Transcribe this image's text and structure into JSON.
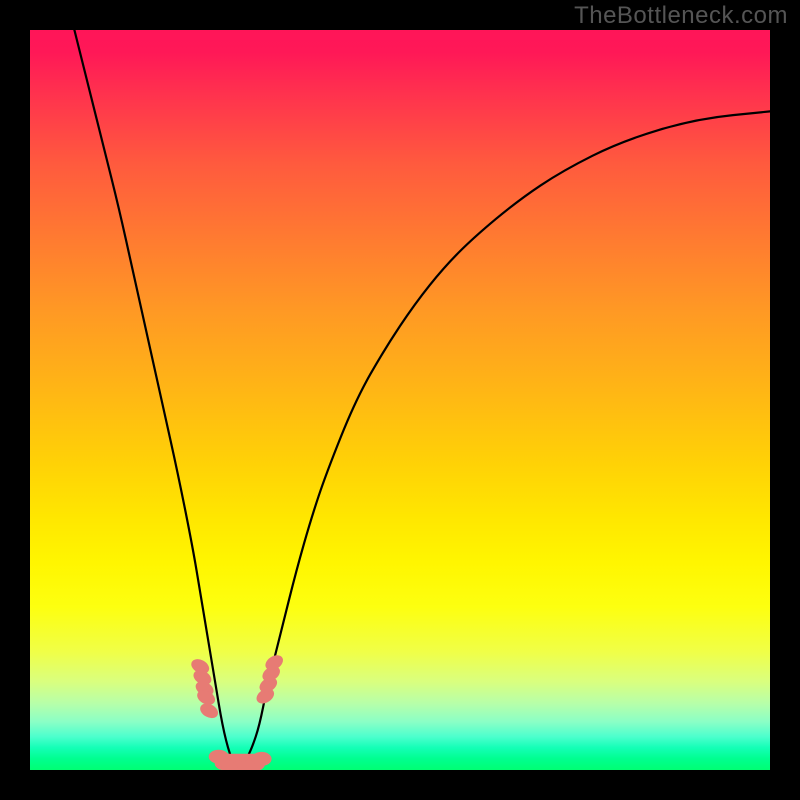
{
  "watermark": "TheBottleneck.com",
  "chart_data": {
    "type": "line",
    "title": "",
    "xlabel": "",
    "ylabel": "",
    "xlim": [
      0,
      100
    ],
    "ylim": [
      0,
      100
    ],
    "grid": false,
    "legend": false,
    "annotations": [],
    "background_gradient": {
      "direction": "vertical",
      "note": "heat-style gradient from pink/red (top, high y) through orange/yellow to green (bottom, low y)",
      "stops": [
        {
          "pos": 0.0,
          "color": "#ff1558"
        },
        {
          "pos": 0.28,
          "color": "#ff7a31"
        },
        {
          "pos": 0.58,
          "color": "#ffd007"
        },
        {
          "pos": 0.78,
          "color": "#fdff10"
        },
        {
          "pos": 0.93,
          "color": "#8affc6"
        },
        {
          "pos": 1.0,
          "color": "#00ff73"
        }
      ]
    },
    "series": [
      {
        "name": "bottleneck-curve",
        "note": "single continuous black curve with a sharp V-shaped minimum near x≈27; y values estimated from vertical position (0 = bottom/green, 100 = top/red)",
        "x": [
          6,
          8,
          10,
          12,
          14,
          16,
          18,
          20,
          22,
          23,
          24,
          25,
          26,
          27,
          28,
          29,
          30,
          31,
          32,
          34,
          36,
          38,
          40,
          44,
          48,
          52,
          56,
          60,
          66,
          72,
          80,
          90,
          100
        ],
        "y": [
          100,
          92,
          84,
          76,
          67,
          58,
          49,
          40,
          30,
          24,
          18,
          12,
          6,
          2,
          0,
          1,
          3,
          6,
          11,
          19,
          27,
          34,
          40,
          50,
          57,
          63,
          68,
          72,
          77,
          81,
          85,
          88,
          89
        ]
      }
    ],
    "markers": [
      {
        "name": "left-cluster",
        "note": "small salmon blobs along the descending limb near the minimum",
        "color": "#e77b74",
        "points": [
          {
            "x": 23.0,
            "y": 14.0
          },
          {
            "x": 23.3,
            "y": 12.5
          },
          {
            "x": 23.6,
            "y": 11.0
          },
          {
            "x": 23.8,
            "y": 9.8
          },
          {
            "x": 24.2,
            "y": 8.0
          }
        ]
      },
      {
        "name": "bottom-cluster",
        "note": "salmon blobs forming a worm along the green floor at the curve minimum",
        "color": "#e77b74",
        "points": [
          {
            "x": 25.5,
            "y": 1.8
          },
          {
            "x": 26.3,
            "y": 0.9
          },
          {
            "x": 27.2,
            "y": 0.4
          },
          {
            "x": 28.3,
            "y": 0.3
          },
          {
            "x": 29.4,
            "y": 0.4
          },
          {
            "x": 30.4,
            "y": 0.8
          },
          {
            "x": 31.3,
            "y": 1.5
          }
        ]
      },
      {
        "name": "right-cluster",
        "note": "small salmon blobs along the ascending limb just right of the minimum",
        "color": "#e77b74",
        "points": [
          {
            "x": 31.8,
            "y": 10.0
          },
          {
            "x": 32.2,
            "y": 11.5
          },
          {
            "x": 32.6,
            "y": 13.0
          },
          {
            "x": 33.0,
            "y": 14.5
          }
        ]
      }
    ]
  }
}
